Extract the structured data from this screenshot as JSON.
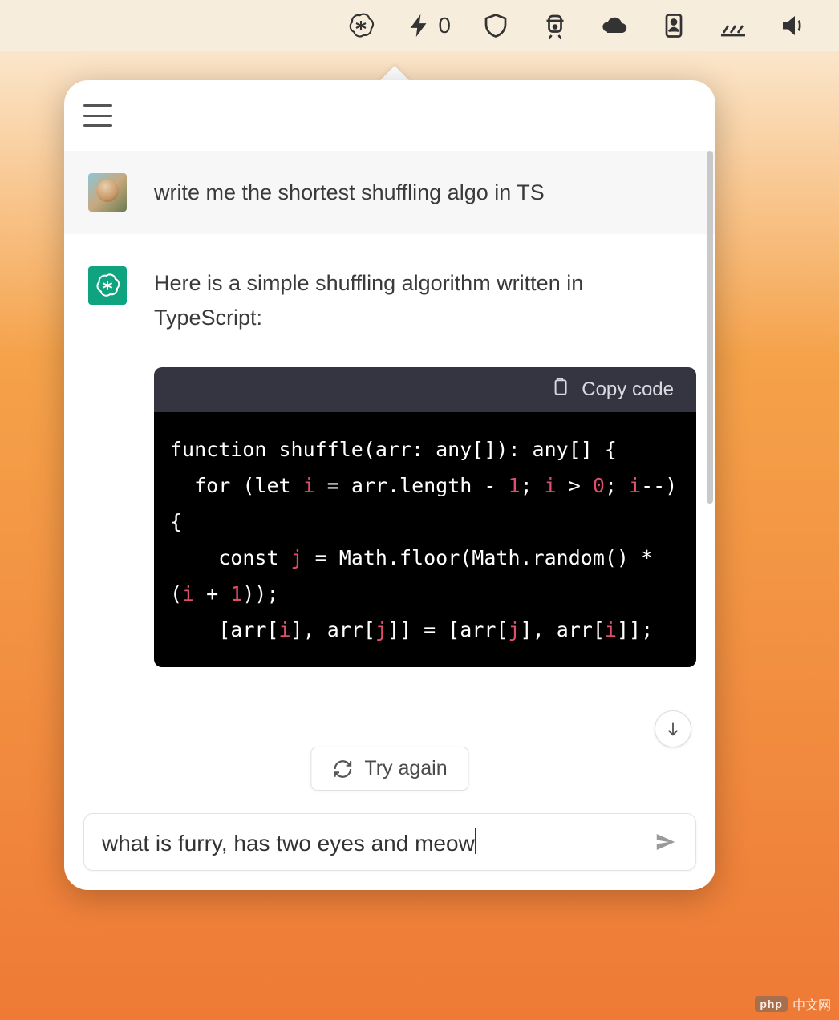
{
  "menubar": {
    "counter_value": "0",
    "icons": [
      "openai-icon",
      "bolt-icon",
      "shield-icon",
      "train-icon",
      "cloud-icon",
      "id-badge-icon",
      "brightness-icon",
      "volume-icon"
    ]
  },
  "header": {
    "menu_label": "Menu"
  },
  "conversation": {
    "user_message": "write me the shortest shuffling algo in TS",
    "ai_intro": "Here is a simple shuffling algorithm written in TypeScript:",
    "code": {
      "copy_label": "Copy code",
      "tokens": [
        {
          "t": "function ",
          "c": "tok-kw"
        },
        {
          "t": "shuffle",
          "c": "tok-fn"
        },
        {
          "t": "(arr: any[]): any[] {\n",
          "c": "tok-op"
        },
        {
          "t": "  for ",
          "c": "tok-kw"
        },
        {
          "t": "(",
          "c": "tok-op"
        },
        {
          "t": "let ",
          "c": "tok-kw"
        },
        {
          "t": "i",
          "c": "tok-var"
        },
        {
          "t": " = arr.length - ",
          "c": "tok-op"
        },
        {
          "t": "1",
          "c": "tok-num"
        },
        {
          "t": "; ",
          "c": "tok-op"
        },
        {
          "t": "i",
          "c": "tok-var"
        },
        {
          "t": " > ",
          "c": "tok-op"
        },
        {
          "t": "0",
          "c": "tok-num"
        },
        {
          "t": "; ",
          "c": "tok-op"
        },
        {
          "t": "i",
          "c": "tok-var"
        },
        {
          "t": "--) {\n",
          "c": "tok-op"
        },
        {
          "t": "    const ",
          "c": "tok-kw"
        },
        {
          "t": "j",
          "c": "tok-var"
        },
        {
          "t": " = Math.floor(Math.random() * (",
          "c": "tok-op"
        },
        {
          "t": "i",
          "c": "tok-var"
        },
        {
          "t": " + ",
          "c": "tok-op"
        },
        {
          "t": "1",
          "c": "tok-num"
        },
        {
          "t": "));\n",
          "c": "tok-op"
        },
        {
          "t": "    [arr[",
          "c": "tok-op"
        },
        {
          "t": "i",
          "c": "tok-var"
        },
        {
          "t": "], arr[",
          "c": "tok-op"
        },
        {
          "t": "j",
          "c": "tok-var"
        },
        {
          "t": "]] = [arr[",
          "c": "tok-op"
        },
        {
          "t": "j",
          "c": "tok-var"
        },
        {
          "t": "], arr[",
          "c": "tok-op"
        },
        {
          "t": "i",
          "c": "tok-var"
        },
        {
          "t": "]];\n",
          "c": "tok-op"
        }
      ]
    }
  },
  "actions": {
    "try_again_label": "Try again"
  },
  "input": {
    "value": "what is furry, has two eyes and meow",
    "placeholder": ""
  },
  "watermark": {
    "logo": "php",
    "text": "中文网"
  }
}
